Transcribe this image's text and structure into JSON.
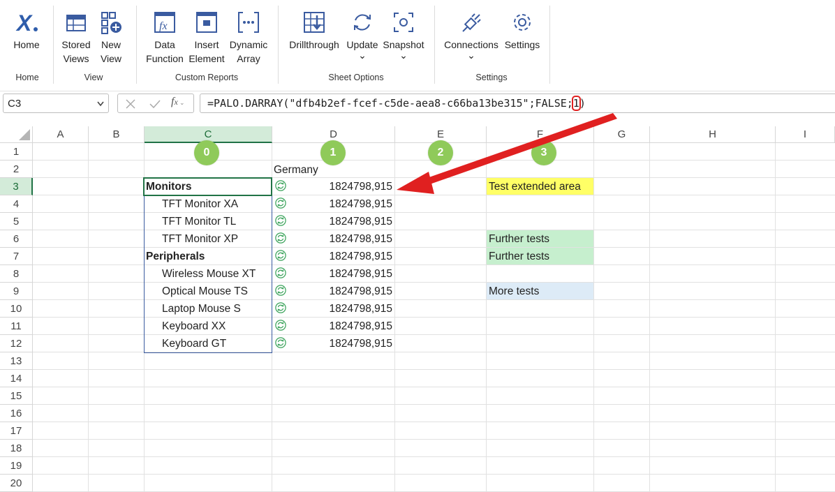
{
  "ribbon": {
    "buttons": {
      "home": "Home",
      "stored_views": [
        "Stored",
        "Views"
      ],
      "new_view": [
        "New",
        "View"
      ],
      "data_function": [
        "Data",
        "Function"
      ],
      "insert_element": [
        "Insert",
        "Element"
      ],
      "dynamic_array": [
        "Dynamic",
        "Array"
      ],
      "drillthrough": "Drillthrough",
      "update": "Update",
      "snapshot": "Snapshot",
      "connections": "Connections",
      "settings": "Settings"
    },
    "groups": {
      "home": "Home",
      "view": "View",
      "custom_reports": "Custom Reports",
      "sheet_options": "Sheet Options",
      "settings": "Settings"
    },
    "chevron": "⌄"
  },
  "formula_bar": {
    "name_box": "C3",
    "formula_prefix": "=PALO.DARRAY(\"dfb4b2ef-fcef-c5de-aea8-c66ba13be315\";FALSE;",
    "formula_highlight": "1",
    "formula_suffix": ")"
  },
  "grid": {
    "columns": [
      "A",
      "B",
      "C",
      "D",
      "E",
      "F",
      "G",
      "H",
      "I"
    ],
    "rows": [
      "1",
      "2",
      "3",
      "4",
      "5",
      "6",
      "7",
      "8",
      "9",
      "10",
      "11",
      "12",
      "13",
      "14",
      "15",
      "16",
      "17",
      "18",
      "19",
      "20"
    ],
    "selected_cell": "C3",
    "badges": [
      "0",
      "1",
      "2",
      "3"
    ],
    "header_d2": "Germany",
    "items": [
      {
        "label": "Monitors",
        "bold": true,
        "value": "1824798,915"
      },
      {
        "label": "TFT Monitor XA",
        "bold": false,
        "value": "1824798,915"
      },
      {
        "label": "TFT Monitor TL",
        "bold": false,
        "value": "1824798,915"
      },
      {
        "label": "TFT Monitor XP",
        "bold": false,
        "value": "1824798,915"
      },
      {
        "label": "Peripherals",
        "bold": true,
        "value": "1824798,915"
      },
      {
        "label": "Wireless Mouse XT",
        "bold": false,
        "value": "1824798,915"
      },
      {
        "label": "Optical Mouse TS",
        "bold": false,
        "value": "1824798,915"
      },
      {
        "label": "Laptop Mouse S",
        "bold": false,
        "value": "1824798,915"
      },
      {
        "label": "Keyboard XX",
        "bold": false,
        "value": "1824798,915"
      },
      {
        "label": "Keyboard GT",
        "bold": false,
        "value": "1824798,915"
      }
    ],
    "f_notes": [
      {
        "row": "3",
        "text": "Test extended area",
        "color": "#ffff66"
      },
      {
        "row": "6",
        "text": "Further tests",
        "color": "#c6efce"
      },
      {
        "row": "7",
        "text": "Further tests",
        "color": "#c6efce"
      },
      {
        "row": "9",
        "text": "More tests",
        "color": "#ddebf7"
      }
    ]
  },
  "colors": {
    "accent_green": "#217346",
    "badge_green": "#8fca5a",
    "arrow_red": "#e02020",
    "icon_blue": "#3a5ba0"
  }
}
